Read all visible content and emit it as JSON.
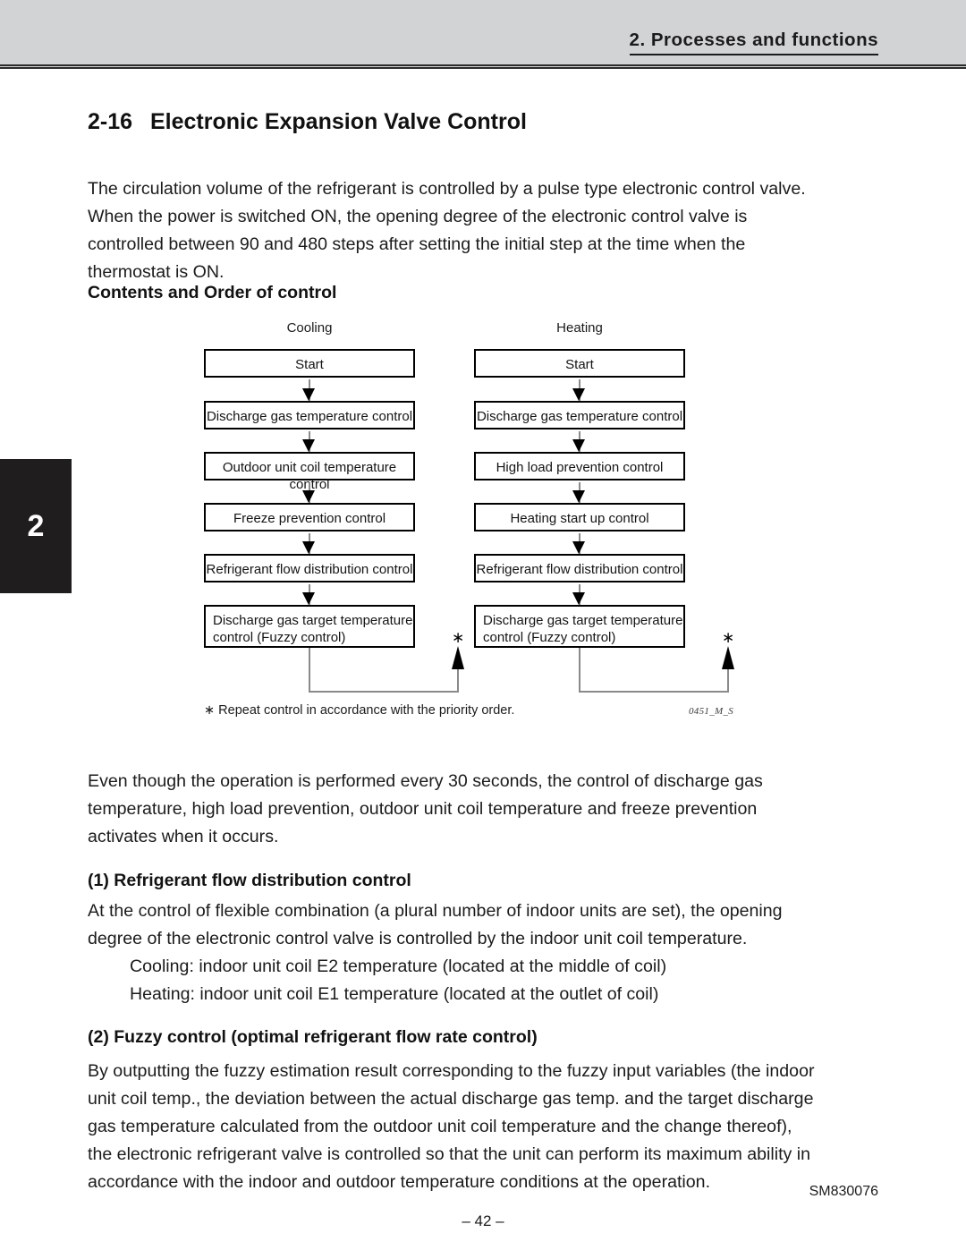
{
  "header": {
    "chapter_title": "2. Processes and functions",
    "chapter_tab_number": "2"
  },
  "section": {
    "number": "2-16",
    "title": "Electronic Expansion Valve Control"
  },
  "intro_paragraph": [
    "The circulation volume of the refrigerant is controlled by a pulse type electronic control valve.",
    "When the power is switched ON, the opening degree of the electronic control valve is",
    "controlled between 90 and 480 steps after setting the initial step at the time when the",
    "thermostat is ON."
  ],
  "contents_heading": "Contents and Order of control",
  "flowchart": {
    "columns": [
      {
        "label": "Cooling",
        "boxes": [
          {
            "text": "Start",
            "align": "center"
          },
          {
            "text": "Discharge gas temperature control",
            "align": "center"
          },
          {
            "text": "Outdoor unit coil temperature control",
            "align": "center"
          },
          {
            "text": "Freeze prevention control",
            "align": "center"
          },
          {
            "text": "Refrigerant flow distribution control",
            "align": "center"
          },
          {
            "text": "Discharge gas target temperature control (Fuzzy control)",
            "align": "left"
          }
        ]
      },
      {
        "label": "Heating",
        "boxes": [
          {
            "text": "Start",
            "align": "center"
          },
          {
            "text": "Discharge gas temperature control",
            "align": "center"
          },
          {
            "text": "High load prevention control",
            "align": "center"
          },
          {
            "text": "Heating start up control",
            "align": "center"
          },
          {
            "text": "Refrigerant flow distribution control",
            "align": "center"
          },
          {
            "text": "Discharge gas target temperature control (Fuzzy control)",
            "align": "left"
          }
        ]
      }
    ],
    "loop_marker": "∗",
    "footnote": "∗ Repeat control in accordance with the priority order.",
    "figure_id": "0451_M_S"
  },
  "even_though_paragraph": [
    "Even though the operation is performed every 30 seconds, the control of discharge gas",
    "temperature, high load prevention, outdoor unit coil temperature and freeze prevention",
    "activates when it occurs."
  ],
  "subsection_1": {
    "heading": "(1) Refrigerant flow distribution control",
    "lines": [
      "At the control of flexible combination (a plural number of  indoor units are set), the opening",
      "degree of the electronic control valve is controlled by the indoor unit coil temperature."
    ],
    "indented_lines": [
      "Cooling: indoor unit coil E2 temperature (located at the middle of coil)",
      "Heating: indoor unit coil E1 temperature (located at the outlet of coil)"
    ]
  },
  "subsection_2": {
    "heading": "(2) Fuzzy control (optimal refrigerant flow rate control)",
    "lines": [
      "By outputting the fuzzy estimation result corresponding to the fuzzy input variables (the indoor",
      "unit coil temp., the deviation between the actual discharge gas temp. and the target discharge",
      "gas temperature calculated from the outdoor unit coil temperature and the change thereof),",
      "the electronic refrigerant valve is controlled so that the unit can perform its maximum ability in",
      "accordance with the indoor and outdoor temperature conditions at the operation."
    ]
  },
  "footer": {
    "page_number": "– 42 –",
    "document_code": "SM830076"
  },
  "colors": {
    "header_band": "#d2d3d5",
    "chapter_tab": "#201d1e",
    "text": "#1b1b1b",
    "connector": "#8a8a8a"
  }
}
